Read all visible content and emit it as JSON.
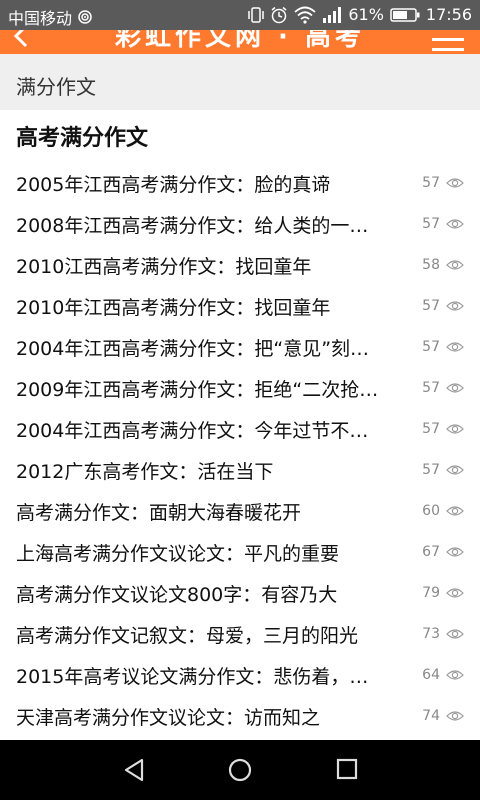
{
  "status": {
    "carrier": "中国移动",
    "battery_percent": "61%",
    "time": "17:56"
  },
  "titlebar": {
    "title": "彩虹作文网 · 高考"
  },
  "breadcrumb": "满分作文",
  "section_title": "高考满分作文",
  "articles": [
    {
      "title": "2005年江西高考满分作文：脸的真谛",
      "views": "57"
    },
    {
      "title": "2008年江西高考满分作文：给人类的一…",
      "views": "57"
    },
    {
      "title": "2010江西高考满分作文：找回童年",
      "views": "58"
    },
    {
      "title": "2010年江西高考满分作文：找回童年",
      "views": "57"
    },
    {
      "title": "2004年江西高考满分作文：把“意见”刻…",
      "views": "57"
    },
    {
      "title": "2009年江西高考满分作文：拒绝“二次抢…",
      "views": "57"
    },
    {
      "title": "2004年江西高考满分作文：今年过节不…",
      "views": "57"
    },
    {
      "title": "2012广东高考作文：活在当下",
      "views": "57"
    },
    {
      "title": "高考满分作文：面朝大海春暖花开",
      "views": "60"
    },
    {
      "title": "上海高考满分作文议论文：平凡的重要",
      "views": "67"
    },
    {
      "title": "高考满分作文议论文800字：有容乃大",
      "views": "79"
    },
    {
      "title": "高考满分作文记叙文：母爱，三月的阳光",
      "views": "73"
    },
    {
      "title": "2015年高考议论文满分作文：悲伤着，…",
      "views": "64"
    },
    {
      "title": "天津高考满分作文议论文：访而知之",
      "views": "74"
    }
  ],
  "colors": {
    "accent": "#ff7a2e",
    "status_bar": "#5a5a5a",
    "nav_bar": "#000000"
  }
}
